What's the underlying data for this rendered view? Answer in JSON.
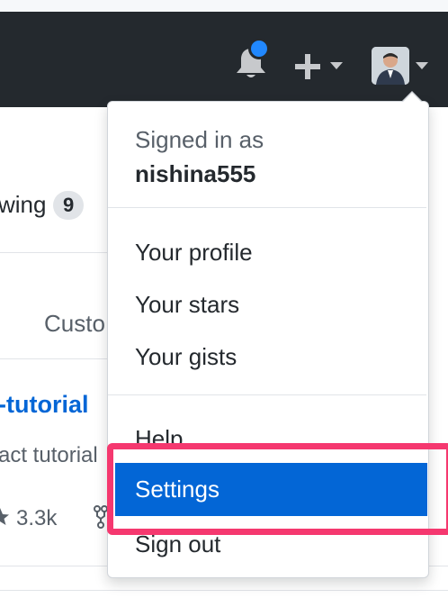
{
  "header": {
    "notification_icon": "bell-icon",
    "create_icon": "plus-icon",
    "avatar_alt": "user-avatar"
  },
  "background": {
    "following_label": "wing",
    "following_count": "9",
    "tab_partial": "Custo",
    "repo_link_partial": "-tutorial",
    "repo_desc_partial": "act tutorial",
    "stars": "3.3k"
  },
  "dropdown": {
    "signed_in_label": "Signed in as",
    "username": "nishina555",
    "items": {
      "profile": "Your profile",
      "stars": "Your stars",
      "gists": "Your gists",
      "help": "Help",
      "settings": "Settings",
      "sign_out": "Sign out"
    }
  },
  "colors": {
    "header_bg": "#24292e",
    "accent": "#0366d6",
    "highlight": "#f5386f",
    "notification_dot": "#2188ff"
  }
}
